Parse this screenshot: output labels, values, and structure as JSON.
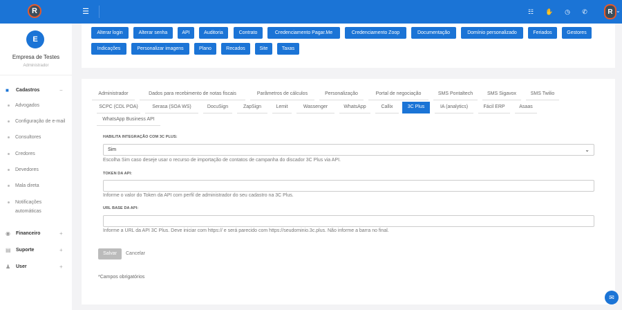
{
  "sidebar": {
    "company_initial": "E",
    "company_name": "Empresa de Testes",
    "company_role": "Administrador",
    "sections": [
      {
        "label": "Cadastros",
        "icon": "folder-icon",
        "sign": "−"
      },
      {
        "label": "Financeiro",
        "icon": "dollar-icon",
        "sign": "+"
      },
      {
        "label": "Suporte",
        "icon": "chat-icon",
        "sign": "+"
      },
      {
        "label": "User",
        "icon": "user-icon",
        "sign": "+"
      }
    ],
    "cadastros_items": [
      "Advogados",
      "Configuração de e-mail",
      "Consultores",
      "Credores",
      "Devedores",
      "Mala direta",
      "Notificações",
      "automáticas"
    ]
  },
  "topbar": {
    "accent": "#1b74d6",
    "user_initial": "R"
  },
  "buttons": [
    "Alterar login",
    "Alterar senha",
    "API",
    "Auditoria",
    "Contrato",
    "Credenciamento Pagar.Me",
    "Credenciamento Zoop",
    "Documentação",
    "Domínio personalizado",
    "Feriados",
    "Gestores",
    "Indicações",
    "Personalizar imagens",
    "Plano",
    "Recados",
    "Site",
    "Taxas"
  ],
  "tabs": [
    "Administrador",
    "Dados para recebimento de notas fiscais",
    "Parâmetros de cálculos",
    "Personalização",
    "Portal de negociação",
    "SMS Pontaltech",
    "SMS Sigavox",
    "SMS Twilio",
    "SCPC (CDL POA)",
    "Serasa (SOA WS)",
    "DocuSign",
    "ZapSign",
    "Lemit",
    "Wassenger",
    "WhatsApp",
    "Callix",
    "3C Plus",
    "IA (analytics)",
    "Fácil ERP",
    "Asaas",
    "WhatsApp Business API"
  ],
  "active_tab": "3C Plus",
  "form": {
    "f1_label": "Habilita integração com 3C Plus:",
    "f1_value": "Sim",
    "f1_help": "Escolha Sim caso deseje usar o recurso de importação de contatos de campanha do discador 3C Plus via API.",
    "f2_label": "Token da API:",
    "f2_value": "",
    "f2_help": "Informe o valor do Token da API com perfil de administrador do seu cadastro na 3C Plus.",
    "f3_label": "URL base da API:",
    "f3_value": "",
    "f3_help": "Informe a URL da API 3C Plus. Deve iniciar com https:// e será parecido com https://seudominio.3c.plus. Não informe a barra no final.",
    "save": "Salvar",
    "cancel": "Cancelar",
    "required_note": "*Campos obrigatórios"
  }
}
